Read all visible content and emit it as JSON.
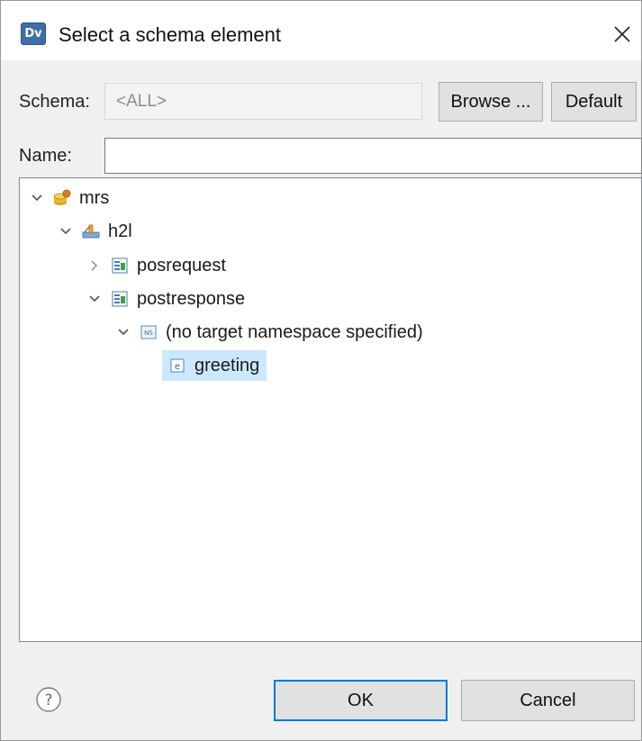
{
  "window": {
    "app_icon_text": "Dv",
    "title": "Select a schema element",
    "close_glyph": "×"
  },
  "schema": {
    "label_prefix": "Schema:",
    "value": "<ALL>",
    "browse_label": "Browse ...",
    "default_label": "Default"
  },
  "name": {
    "label": "Name:",
    "value": "",
    "placeholder": ""
  },
  "tree": {
    "nodes": [
      {
        "label": "mrs",
        "icon": "repository-icon",
        "expanded": true,
        "depth": 0
      },
      {
        "label": "h2l",
        "icon": "project-icon",
        "expanded": true,
        "depth": 1
      },
      {
        "label": "posrequest",
        "icon": "xsd-file-icon",
        "expanded": false,
        "depth": 2
      },
      {
        "label": "postresponse",
        "icon": "xsd-file-icon",
        "expanded": true,
        "depth": 2
      },
      {
        "label": "(no target namespace specified)",
        "icon": "namespace-icon",
        "expanded": true,
        "depth": 3
      },
      {
        "label": "greeting",
        "icon": "element-icon",
        "selected": true,
        "depth": 4
      }
    ]
  },
  "footer": {
    "help_glyph": "?",
    "ok_label": "OK",
    "cancel_label": "Cancel"
  },
  "colors": {
    "selection": "#cce8ff",
    "focus_border": "#0078d7",
    "dialog_bg": "#f0f0f0"
  }
}
